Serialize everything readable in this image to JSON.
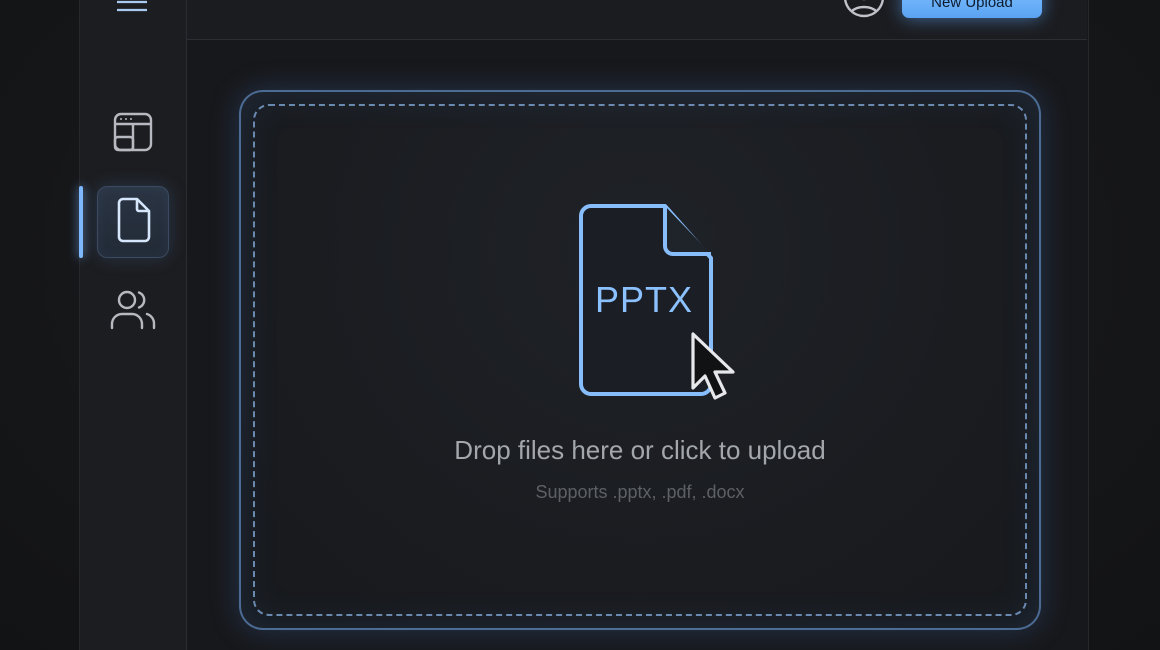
{
  "header": {
    "new_upload_label": "New Upload"
  },
  "sidebar": {
    "items": [
      {
        "name": "dashboard",
        "icon": "layout-dashboard-icon"
      },
      {
        "name": "files",
        "icon": "file-icon",
        "active": true
      },
      {
        "name": "team",
        "icon": "users-icon"
      }
    ]
  },
  "dropzone": {
    "file_type": "PPTX",
    "title": "Drop files here or click to upload",
    "subtitle": "Supports .pptx, .pdf, .docx"
  },
  "colors": {
    "accent": "#7cc0ff",
    "background": "#17181b",
    "sidebar": "#1c1d20"
  }
}
